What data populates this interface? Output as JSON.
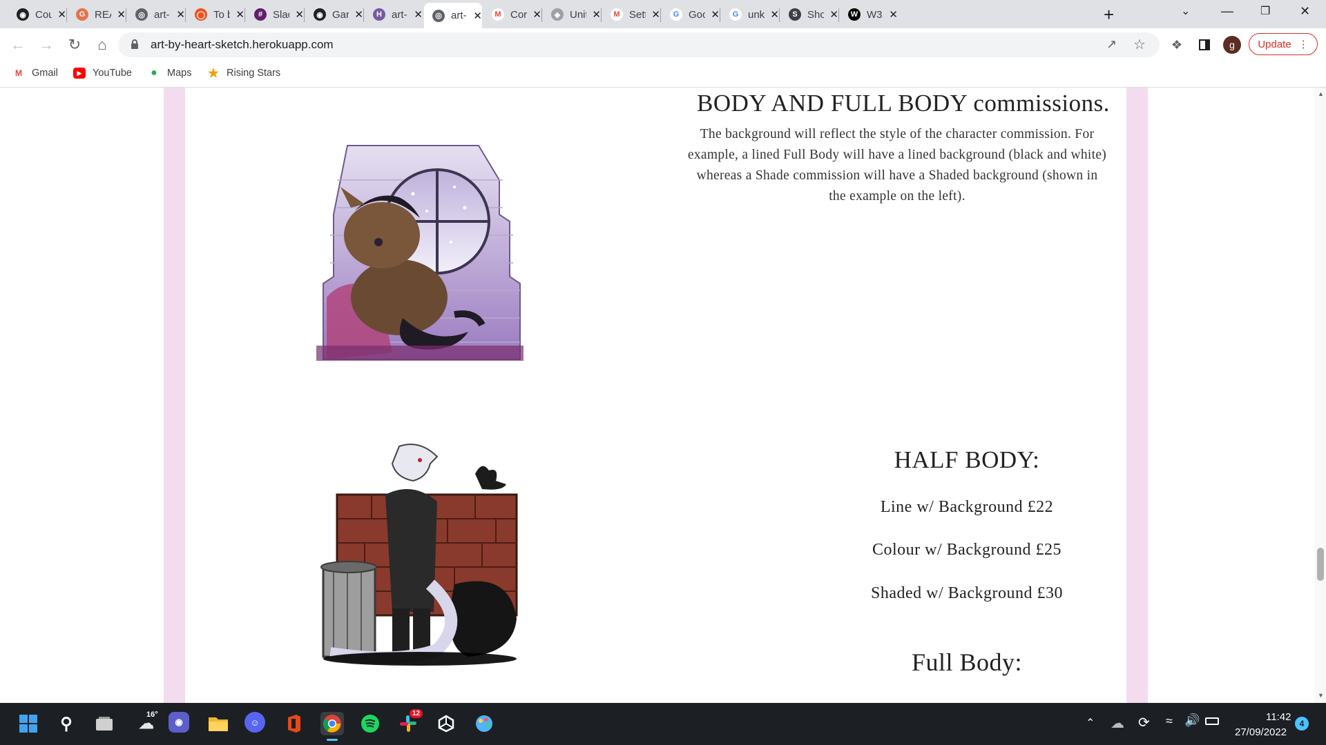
{
  "browser": {
    "tabs": [
      {
        "label": "Cou",
        "icon": "github-icon",
        "active": false
      },
      {
        "label": "REA",
        "icon": "grammarly-icon",
        "active": false
      },
      {
        "label": "art-",
        "icon": "globe-icon",
        "active": false
      },
      {
        "label": "To b",
        "icon": "todo-icon",
        "active": false
      },
      {
        "label": "Slac",
        "icon": "slack-icon",
        "active": false
      },
      {
        "label": "Gar",
        "icon": "github-icon",
        "active": false
      },
      {
        "label": "art-",
        "icon": "heroku-icon",
        "active": false
      },
      {
        "label": "art-",
        "icon": "globe-icon",
        "active": true
      },
      {
        "label": "Cor",
        "icon": "gmail-icon",
        "active": false
      },
      {
        "label": "Unit",
        "icon": "unity-icon",
        "active": false
      },
      {
        "label": "Sett",
        "icon": "gmail-icon",
        "active": false
      },
      {
        "label": "Goo",
        "icon": "google-icon",
        "active": false
      },
      {
        "label": "unk",
        "icon": "google-icon",
        "active": false
      },
      {
        "label": "Sho",
        "icon": "shop-icon",
        "active": false
      },
      {
        "label": "W3",
        "icon": "w3schools-icon",
        "active": false
      }
    ],
    "new_tab_label": "+",
    "url": "art-by-heart-sketch.herokuapp.com",
    "update_label": "Update",
    "profile_initial": "g",
    "bookmarks": [
      {
        "label": "Gmail",
        "icon": "gmail-icon"
      },
      {
        "label": "YouTube",
        "icon": "youtube-icon"
      },
      {
        "label": "Maps",
        "icon": "maps-icon"
      },
      {
        "label": "Rising Stars",
        "icon": "star-icon"
      }
    ]
  },
  "page": {
    "section_heading": "BODY AND FULL BODY commissions.",
    "background_paragraph": [
      "The background will reflect the style of the character commission. For",
      "example, a lined Full Body will have a lined background (black and white)",
      "whereas a Shade commission will have a Shaded background (shown in",
      "the example on the left)."
    ],
    "half_body": {
      "title": "HALF BODY:",
      "prices": [
        "Line w/ Background £22",
        "Colour w/ Background £25",
        "Shaded w/ Background £30"
      ]
    },
    "full_body": {
      "title": "Full Body:"
    }
  },
  "taskbar": {
    "weather": "16°",
    "slack_badge": "12",
    "time": "11:42",
    "date": "27/09/2022",
    "notification_count": "4"
  },
  "colors": {
    "pink_band": "#f4dcef",
    "update_red": "#d93025",
    "taskbar_bg": "#1c1f24"
  }
}
